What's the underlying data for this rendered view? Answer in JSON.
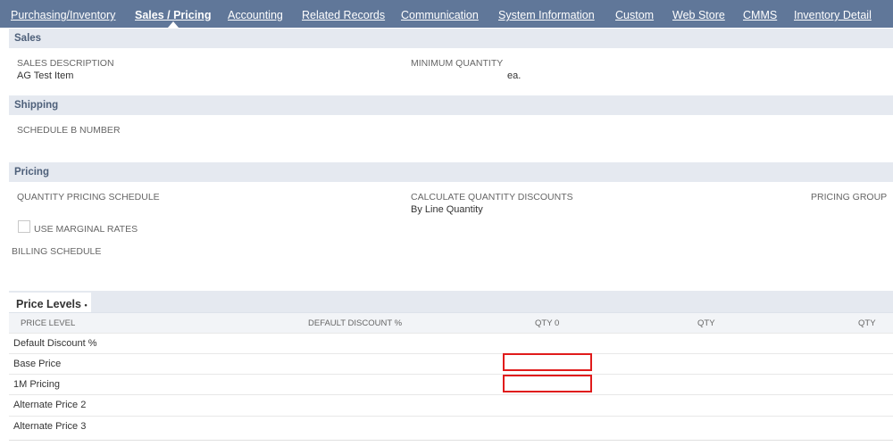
{
  "tabs": [
    {
      "label": "Purchasing/Inventory",
      "active": false
    },
    {
      "label": "Sales / Pricing",
      "active": true
    },
    {
      "label": "Accounting",
      "active": false
    },
    {
      "label": "Related Records",
      "active": false
    },
    {
      "label": "Communication",
      "active": false
    },
    {
      "label": "System Information",
      "active": false
    },
    {
      "label": "Custom",
      "active": false
    },
    {
      "label": "Web Store",
      "active": false
    },
    {
      "label": "CMMS",
      "active": false
    },
    {
      "label": "Inventory Detail",
      "active": false
    }
  ],
  "sales": {
    "title": "Sales",
    "description_label": "SALES DESCRIPTION",
    "description_value": "AG Test Item",
    "min_qty_label": "MINIMUM QUANTITY",
    "min_qty_unit": "ea."
  },
  "shipping": {
    "title": "Shipping",
    "schedule_b_label": "SCHEDULE B NUMBER"
  },
  "pricing": {
    "title": "Pricing",
    "qty_schedule_label": "QUANTITY PRICING SCHEDULE",
    "calc_discounts_label": "CALCULATE QUANTITY DISCOUNTS",
    "calc_discounts_value": "By Line Quantity",
    "pricing_group_label": "PRICING GROUP",
    "marginal_rates_label": "USE MARGINAL RATES",
    "marginal_rates_checked": false,
    "billing_schedule_label": "BILLING SCHEDULE"
  },
  "price_levels": {
    "title": "Price Levels",
    "title_marker": "•",
    "columns": [
      "PRICE LEVEL",
      "DEFAULT DISCOUNT %",
      "QTY 0",
      "QTY",
      "QTY"
    ],
    "rows": [
      {
        "name": "Default Discount %",
        "has_input": false
      },
      {
        "name": "Base Price",
        "has_input": true,
        "qty0": ""
      },
      {
        "name": "1M Pricing",
        "has_input": true,
        "qty0": ""
      },
      {
        "name": "Alternate Price 2",
        "has_input": false
      },
      {
        "name": "Alternate Price 3",
        "has_input": false
      }
    ]
  },
  "colors": {
    "tab_bar": "#607799",
    "section_header": "#e5e9f0",
    "section_title": "#4d5f79",
    "highlight_border": "#e01b1b"
  }
}
